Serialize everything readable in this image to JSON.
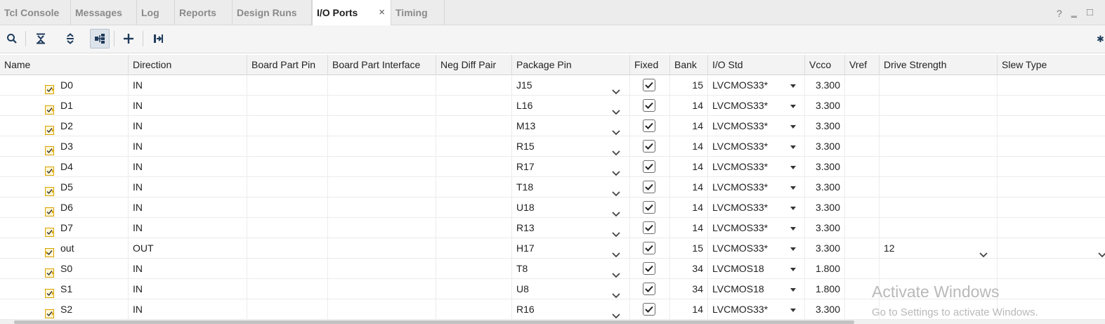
{
  "tabs": [
    {
      "label": "Tcl Console"
    },
    {
      "label": "Messages"
    },
    {
      "label": "Log"
    },
    {
      "label": "Reports"
    },
    {
      "label": "Design Runs"
    },
    {
      "label": "I/O Ports"
    },
    {
      "label": "Timing"
    }
  ],
  "active_tab_close": "×",
  "window_controls": {
    "help": "?",
    "minimize": "‗",
    "maximize": "□"
  },
  "columns": [
    "Name",
    "Direction",
    "Board Part Pin",
    "Board Part Interface",
    "Neg Diff Pair",
    "Package Pin",
    "Fixed",
    "Bank",
    "I/O Std",
    "Vcco",
    "Vref",
    "Drive Strength",
    "Slew Type"
  ],
  "rows": [
    {
      "name": "D0",
      "direction": "IN",
      "package_pin": "J15",
      "fixed": true,
      "bank": "15",
      "io_std": "LVCMOS33*",
      "vcco": "3.300",
      "drive_strength": "",
      "type": "input"
    },
    {
      "name": "D1",
      "direction": "IN",
      "package_pin": "L16",
      "fixed": true,
      "bank": "14",
      "io_std": "LVCMOS33*",
      "vcco": "3.300",
      "drive_strength": "",
      "type": "input"
    },
    {
      "name": "D2",
      "direction": "IN",
      "package_pin": "M13",
      "fixed": true,
      "bank": "14",
      "io_std": "LVCMOS33*",
      "vcco": "3.300",
      "drive_strength": "",
      "type": "input"
    },
    {
      "name": "D3",
      "direction": "IN",
      "package_pin": "R15",
      "fixed": true,
      "bank": "14",
      "io_std": "LVCMOS33*",
      "vcco": "3.300",
      "drive_strength": "",
      "type": "input"
    },
    {
      "name": "D4",
      "direction": "IN",
      "package_pin": "R17",
      "fixed": true,
      "bank": "14",
      "io_std": "LVCMOS33*",
      "vcco": "3.300",
      "drive_strength": "",
      "type": "input"
    },
    {
      "name": "D5",
      "direction": "IN",
      "package_pin": "T18",
      "fixed": true,
      "bank": "14",
      "io_std": "LVCMOS33*",
      "vcco": "3.300",
      "drive_strength": "",
      "type": "input"
    },
    {
      "name": "D6",
      "direction": "IN",
      "package_pin": "U18",
      "fixed": true,
      "bank": "14",
      "io_std": "LVCMOS33*",
      "vcco": "3.300",
      "drive_strength": "",
      "type": "input"
    },
    {
      "name": "D7",
      "direction": "IN",
      "package_pin": "R13",
      "fixed": true,
      "bank": "14",
      "io_std": "LVCMOS33*",
      "vcco": "3.300",
      "drive_strength": "",
      "type": "input"
    },
    {
      "name": "out",
      "direction": "OUT",
      "package_pin": "H17",
      "fixed": true,
      "bank": "15",
      "io_std": "LVCMOS33*",
      "vcco": "3.300",
      "drive_strength": "12",
      "type": "output"
    },
    {
      "name": "S0",
      "direction": "IN",
      "package_pin": "T8",
      "fixed": true,
      "bank": "34",
      "io_std": "LVCMOS18",
      "vcco": "1.800",
      "drive_strength": "",
      "type": "input"
    },
    {
      "name": "S1",
      "direction": "IN",
      "package_pin": "U8",
      "fixed": true,
      "bank": "34",
      "io_std": "LVCMOS18",
      "vcco": "1.800",
      "drive_strength": "",
      "type": "input"
    },
    {
      "name": "S2",
      "direction": "IN",
      "package_pin": "R16",
      "fixed": true,
      "bank": "14",
      "io_std": "LVCMOS33*",
      "vcco": "3.300",
      "drive_strength": "",
      "type": "input"
    }
  ],
  "watermark": {
    "title": "Activate Windows",
    "subtitle": "Go to Settings to activate Windows."
  },
  "colors": {
    "port_icon": "#d9a200",
    "active_tab_bg": "#ffffff",
    "tool_icon": "#1f3b5c"
  }
}
